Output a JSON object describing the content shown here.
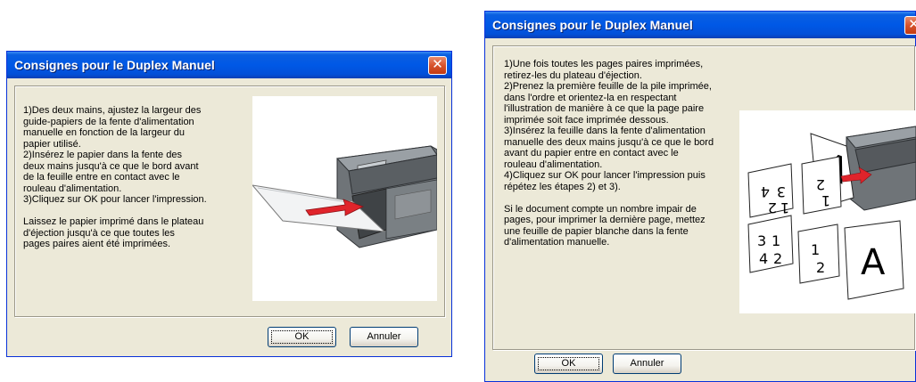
{
  "dialog_left": {
    "title": "Consignes pour le Duplex Manuel",
    "close_glyph": "✕",
    "instructions": "1)Des deux mains, ajustez la largeur des\nguide-papiers de la fente d'alimentation\nmanuelle en fonction de la largeur du\npapier utilisé.\n2)Insérez le papier dans la fente des\ndeux mains jusqu'à ce que le bord avant\nde la feuille entre en contact avec le\nrouleau d'alimentation.\n3)Cliquez sur OK pour lancer l'impression.\n\nLaissez le papier imprimé dans le plateau\nd'éjection jusqu'à ce que toutes les\npages paires aient été imprimées.",
    "ok_label": "OK",
    "cancel_label": "Annuler",
    "illustration": "printer-feed-illustration"
  },
  "dialog_right": {
    "title": "Consignes pour le Duplex Manuel",
    "close_glyph": "✕",
    "instructions": "1)Une fois toutes les pages paires imprimées,\nretirez-les du plateau d'éjection.\n2)Prenez la première feuille de la pile imprimée,\ndans l'ordre et orientez-la en respectant\nl'illustration de manière à ce que la page paire\nimprimée soit face imprimée dessous.\n3)Insérez la feuille dans la fente d'alimentation\nmanuelle des deux mains jusqu'à ce que le bord\navant du papier entre en contact avec le\nrouleau d'alimentation.\n4)Cliquez sur OK pour lancer l'impression puis\nrépétez les étapes 2) et 3).\n\n Si le document compte un nombre impair de\npages, pour imprimer la dernière page, mettez\nune feuille de papier blanche dans la fente\nd'alimentation manuelle.",
    "ok_label": "OK",
    "cancel_label": "Annuler",
    "illustration": "page-order-illustration"
  },
  "colors": {
    "title_bar": "#0058e6",
    "dialog_bg": "#ece9d8",
    "close_button": "#d7532d",
    "arrow": "#e0242b"
  }
}
